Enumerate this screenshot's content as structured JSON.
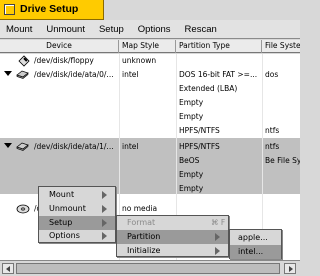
{
  "window": {
    "title": "Drive Setup"
  },
  "menubar": [
    "Mount",
    "Unmount",
    "Setup",
    "Options",
    "Rescan"
  ],
  "columns": [
    "Device",
    "Map Style",
    "Partition Type",
    "File System"
  ],
  "rows": [
    {
      "device": "/dev/disk/floppy",
      "map": "unknown",
      "partition": "",
      "fs": ""
    },
    {
      "device": "/dev/disk/ide/ata/0/...",
      "map": "intel",
      "partition": "DOS 16-bit FAT >=...",
      "fs": "dos"
    },
    {
      "device": "",
      "map": "",
      "partition": "Extended (LBA)",
      "fs": ""
    },
    {
      "device": "",
      "map": "",
      "partition": "Empty",
      "fs": ""
    },
    {
      "device": "",
      "map": "",
      "partition": "Empty",
      "fs": ""
    },
    {
      "device": "",
      "map": "",
      "partition": "HPFS/NTFS",
      "fs": "ntfs"
    },
    {
      "device": "/dev/disk/ide/ata/1/...",
      "map": "intel",
      "partition": "HPFS/NTFS",
      "fs": "ntfs"
    },
    {
      "device": "",
      "map": "",
      "partition": "BeOS",
      "fs": "Be File System"
    },
    {
      "device": "",
      "map": "",
      "partition": "Empty",
      "fs": ""
    },
    {
      "device": "",
      "map": "",
      "partition": "Empty",
      "fs": ""
    },
    {
      "device": "/d",
      "map": "no media",
      "partition": "",
      "fs": ""
    }
  ],
  "context_menu": {
    "items": [
      "Mount",
      "Unmount",
      "Setup",
      "Options"
    ]
  },
  "setup_submenu": {
    "items": [
      "Format",
      "Partition",
      "Initialize"
    ],
    "format_shortcut": "⌘ F"
  },
  "partition_submenu": {
    "items": [
      "apple...",
      "intel..."
    ]
  },
  "colors": {
    "title_tab": "#ffcb00",
    "selection": "#c0c0c0",
    "menu_highlight": "#9a9a9a"
  }
}
